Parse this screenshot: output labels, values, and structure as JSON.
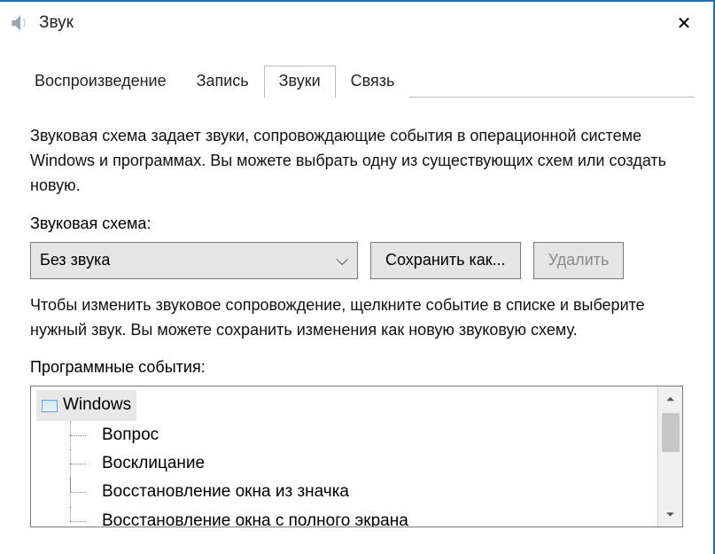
{
  "window": {
    "title": "Звук",
    "close_glyph": "✕"
  },
  "tabs": [
    {
      "label": "Воспроизведение",
      "active": false
    },
    {
      "label": "Запись",
      "active": false
    },
    {
      "label": "Звуки",
      "active": true
    },
    {
      "label": "Связь",
      "active": false
    }
  ],
  "description": "Звуковая схема задает звуки, сопровождающие события в операционной системе Windows и программах. Вы можете выбрать одну из существующих схем или создать новую.",
  "scheme_label": "Звуковая схема:",
  "scheme_combo": {
    "value": "Без звука",
    "chevron": "⌵"
  },
  "buttons": {
    "save_as": "Сохранить как...",
    "delete": "Удалить"
  },
  "events_help": "Чтобы изменить звуковое сопровождение, щелкните событие в списке и выберите нужный звук. Вы можете сохранить изменения как новую звуковую схему.",
  "events_label": "Программные события:",
  "tree": {
    "root": "Windows",
    "items": [
      "Вопрос",
      "Восклицание",
      "Восстановление окна из значка",
      "Восстановление окна с полного экрана"
    ]
  },
  "scroll": {
    "up": "⏶",
    "down": "⏷"
  }
}
